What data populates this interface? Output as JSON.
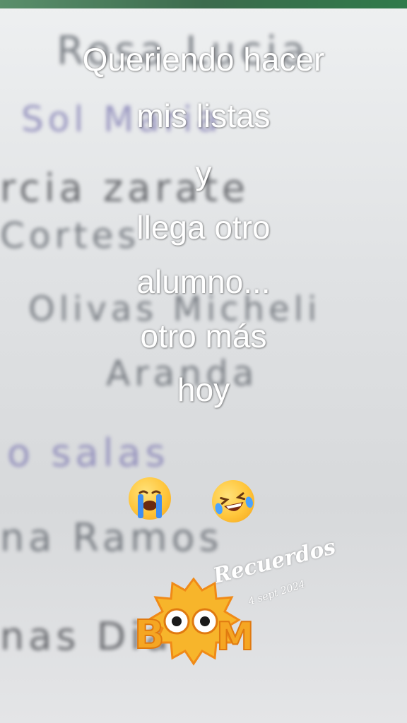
{
  "overlay": {
    "lines": [
      "Queriendo hacer",
      "mis listas",
      "y",
      "llega otro",
      "alumno...",
      "otro más",
      "hoy"
    ]
  },
  "emojis": {
    "left": "crying-face",
    "right": "laughing-face"
  },
  "sticker": {
    "title": "Recuerdos",
    "date": "4 sept 2024",
    "boom": "BOOM"
  },
  "background_handwriting": [
    "Rosa Lucia",
    "Sol Maria",
    "rcia zarate",
    "Cortes",
    "Olivas Micheli",
    "Aranda",
    "o salas",
    "na Ramos",
    "nas Diaz"
  ],
  "colors": {
    "overlay_text": "#ffffff",
    "boom_orange": "#f5a623",
    "emoji_yellow": "#ffc53a"
  }
}
